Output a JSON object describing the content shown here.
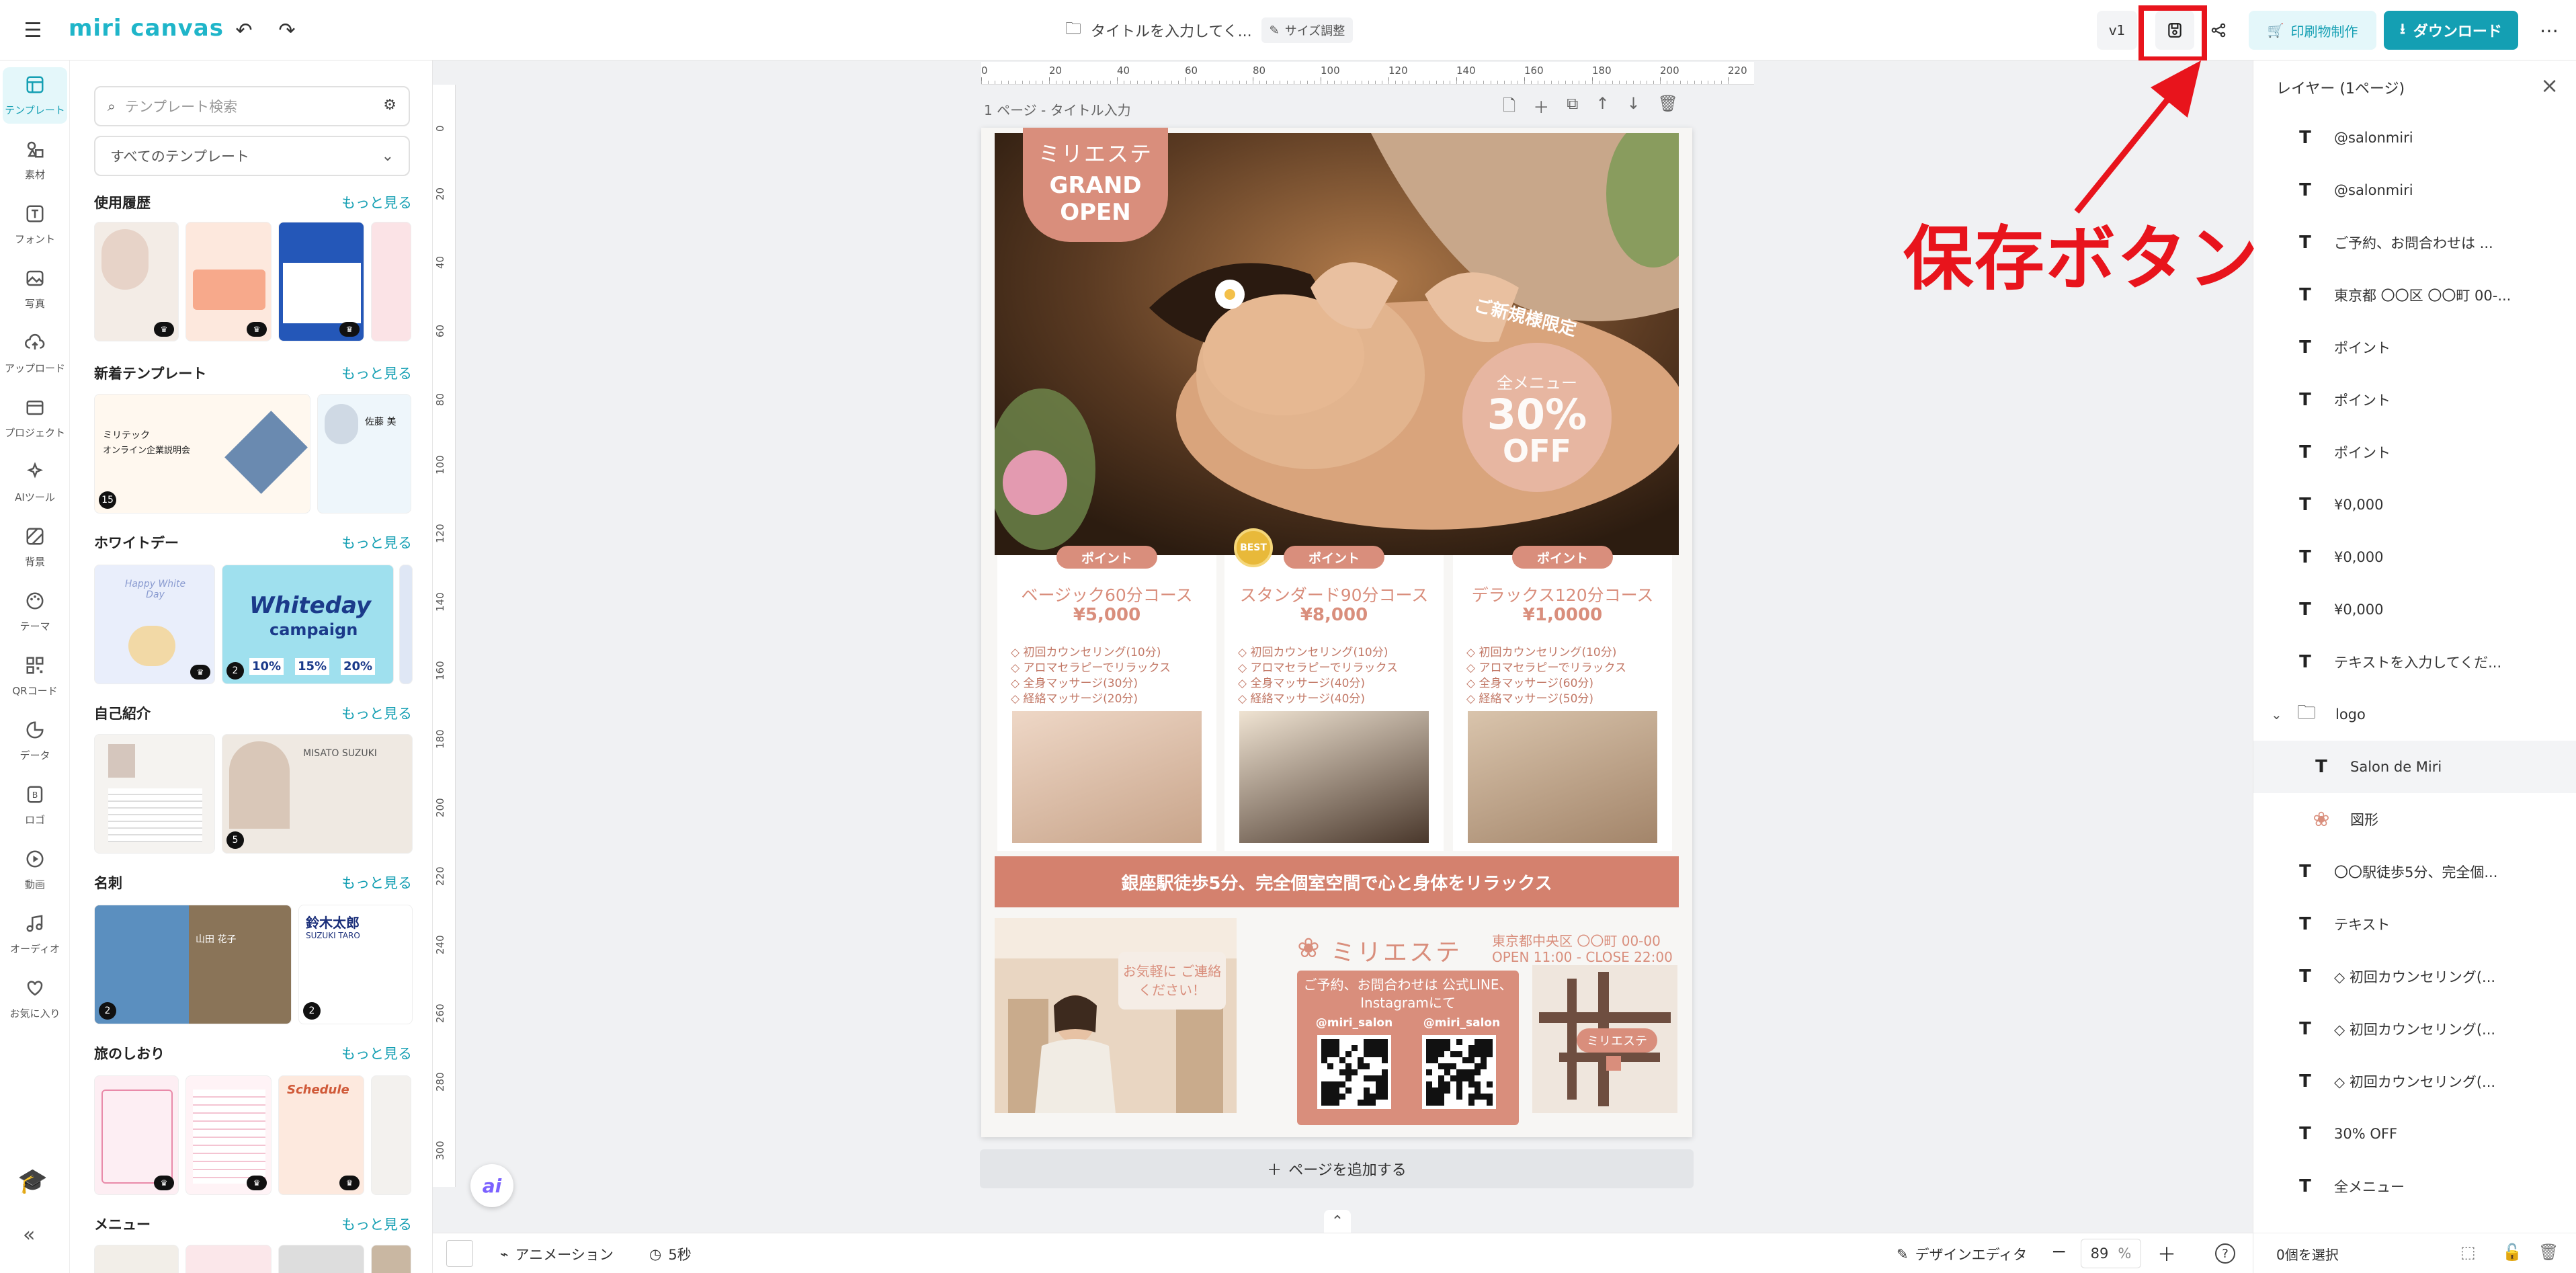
{
  "app": {
    "logo_text": "miri canvas",
    "doc_title": "タイトルを入力してく...",
    "size_adjust": "サイズ調整",
    "version": "v1",
    "print_label": "印刷物制作",
    "download_label": "ダウンロード"
  },
  "rail": {
    "items": [
      {
        "label": "テンプレート",
        "icon": "template-icon"
      },
      {
        "label": "素材",
        "icon": "elements-icon"
      },
      {
        "label": "フォント",
        "icon": "font-icon"
      },
      {
        "label": "写真",
        "icon": "photo-icon"
      },
      {
        "label": "アップロード",
        "icon": "upload-icon"
      },
      {
        "label": "プロジェクト",
        "icon": "project-icon"
      },
      {
        "label": "AIツール",
        "icon": "ai-tools-icon"
      },
      {
        "label": "背景",
        "icon": "background-icon"
      },
      {
        "label": "テーマ",
        "icon": "theme-icon"
      },
      {
        "label": "QRコード",
        "icon": "qrcode-icon"
      },
      {
        "label": "データ",
        "icon": "data-icon"
      },
      {
        "label": "ロゴ",
        "icon": "logo-icon"
      },
      {
        "label": "動画",
        "icon": "video-icon"
      },
      {
        "label": "オーディオ",
        "icon": "audio-icon"
      },
      {
        "label": "お気に入り",
        "icon": "heart-icon"
      }
    ]
  },
  "panel": {
    "search_placeholder": "テンプレート検索",
    "select_value": "すべてのテンプレート",
    "more_label": "もっと見る",
    "sections": [
      "使用履歴",
      "新着テンプレート",
      "ホワイトデー",
      "自己紹介",
      "名刺",
      "旅のしおり",
      "メニュー"
    ],
    "thumb_texts": {
      "new_a1": "ミリテック",
      "new_a2": "オンライン企業説明会",
      "new_b": "佐藤 美",
      "wd_a": "Happy White Day",
      "wd_b1": "Whiteday",
      "wd_b2": "campaign",
      "wd_b3": "10%",
      "wd_b4": "15%",
      "wd_b5": "20%",
      "intro_b": "MISATO SUZUKI",
      "card_a": "山田 花子",
      "card_b1": "鈴木太郎",
      "card_b2": "SUZUKI TARO",
      "trip_c": "Schedule",
      "counts": {
        "new": "15",
        "wd": "2",
        "intro": "5",
        "card_a": "2",
        "card_b": "2"
      }
    }
  },
  "canvas": {
    "page_label": "1 ページ - タイトル入力",
    "add_page_label": "ページを追加する",
    "ruler_h": [
      "0",
      "20",
      "40",
      "60",
      "80",
      "100",
      "120",
      "140",
      "160",
      "180",
      "200",
      "220"
    ],
    "ruler_v": [
      "0",
      "20",
      "40",
      "60",
      "80",
      "100",
      "120",
      "140",
      "160",
      "180",
      "200",
      "220",
      "240",
      "260",
      "280",
      "300"
    ]
  },
  "poster": {
    "shop_name": "ミリエステ",
    "grand_open": "GRAND OPEN",
    "limited": "ご新規様限定",
    "all_menu": "全メニュー",
    "discount": "30%",
    "off": "OFF",
    "point_label": "ポイント",
    "best": "BEST",
    "courses": [
      {
        "name": "ベージック60分コース",
        "price": "¥5,000",
        "items": [
          "◇ 初回カウンセリング(10分)",
          "◇ アロマセラピーでリラックス",
          "◇ 全身マッサージ(30分)",
          "◇ 経絡マッサージ(20分)"
        ]
      },
      {
        "name": "スタンダード90分コース",
        "price": "¥8,000",
        "items": [
          "◇ 初回カウンセリング(10分)",
          "◇ アロマセラピーでリラックス",
          "◇ 全身マッサージ(40分)",
          "◇ 経絡マッサージ(40分)"
        ]
      },
      {
        "name": "デラックス120分コース",
        "price": "¥1,0000",
        "items": [
          "◇ 初回カウンセリング(10分)",
          "◇ アロマセラピーでリラックス",
          "◇ 全身マッサージ(60分)",
          "◇ 経絡マッサージ(50分)"
        ]
      }
    ],
    "banner": "銀座駅徒歩5分、完全個室空間で心と身体をリラックス",
    "speech": "お気軽に ご連絡ください！",
    "address": "東京都中央区 〇〇町 00-00",
    "hours": "OPEN 11:00 - CLOSE 22:00",
    "contact": "ご予約、お問合わせは 公式LINE、Instagramにて",
    "line_id": "@miri_salon",
    "insta_id": "@miri_salon",
    "map_label": "ミリエステ"
  },
  "bottombar": {
    "animation": "アニメーション",
    "duration": "5秒",
    "design_editor": "デザインエディタ",
    "zoom": "89",
    "zoom_unit": "%"
  },
  "layers": {
    "title": "レイヤー (1ページ)",
    "items": [
      {
        "name": "@salonmiri",
        "type": "text"
      },
      {
        "name": "@salonmiri",
        "type": "text"
      },
      {
        "name": "ご予約、お問合わせは ...",
        "type": "text"
      },
      {
        "name": "東京都 〇〇区 〇〇町 00-...",
        "type": "text"
      },
      {
        "name": "ポイント",
        "type": "text"
      },
      {
        "name": "ポイント",
        "type": "text"
      },
      {
        "name": "ポイント",
        "type": "text"
      },
      {
        "name": "¥0,000",
        "type": "text"
      },
      {
        "name": "¥0,000",
        "type": "text"
      },
      {
        "name": "¥0,000",
        "type": "text"
      },
      {
        "name": "テキストを入力してくだ...",
        "type": "text"
      },
      {
        "name": "logo",
        "type": "group"
      },
      {
        "name": "Salon de Miri",
        "type": "text-child"
      },
      {
        "name": "図形",
        "type": "shape-child"
      },
      {
        "name": "〇〇駅徒歩5分、完全個...",
        "type": "text"
      },
      {
        "name": "テキスト",
        "type": "text"
      },
      {
        "name": "◇ 初回カウンセリング(...",
        "type": "text"
      },
      {
        "name": "◇ 初回カウンセリング(...",
        "type": "text"
      },
      {
        "name": "◇ 初回カウンセリング(...",
        "type": "text"
      },
      {
        "name": "30% OFF",
        "type": "text"
      },
      {
        "name": "全メニュー",
        "type": "text"
      }
    ],
    "selected_count": "0個を選択"
  },
  "annotation": {
    "text": "保存ボタン",
    "color": "#e8141c"
  },
  "colors": {
    "accent": "#149fb3",
    "poster_salmon": "#d98e7c",
    "poster_banner": "#d4816e"
  }
}
